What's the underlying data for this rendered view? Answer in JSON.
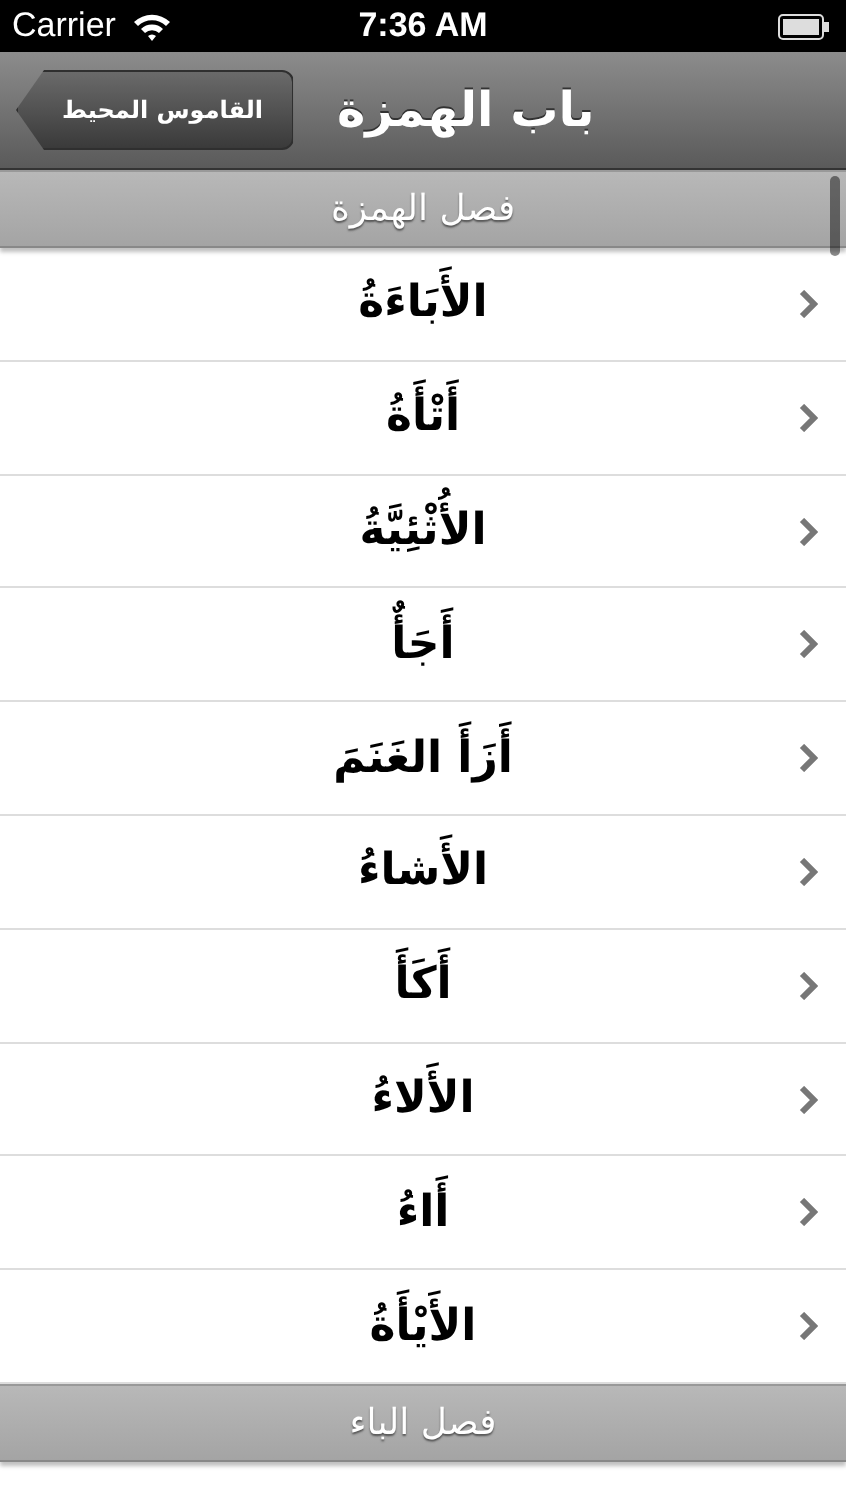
{
  "status_bar": {
    "carrier": "Carrier",
    "time": "7:36 AM"
  },
  "nav_bar": {
    "title": "باب الهمزة",
    "back_button": "القاموس المحيط"
  },
  "sections": [
    {
      "title": "فصل الهمزة",
      "rows": [
        {
          "label": "الأَبَاءَةُ"
        },
        {
          "label": "أَتْأَةُ"
        },
        {
          "label": "الأُثْئِيَّةُ"
        },
        {
          "label": "أَجَأٌ"
        },
        {
          "label": "أَزَأَ الغَنَمَ"
        },
        {
          "label": "الأَشاءُ"
        },
        {
          "label": "أَكَأَ"
        },
        {
          "label": "الأَلاءُ"
        },
        {
          "label": "أَاءُ"
        },
        {
          "label": "الأَيْأَةُ"
        }
      ]
    },
    {
      "title": "فصل الباء"
    }
  ]
}
